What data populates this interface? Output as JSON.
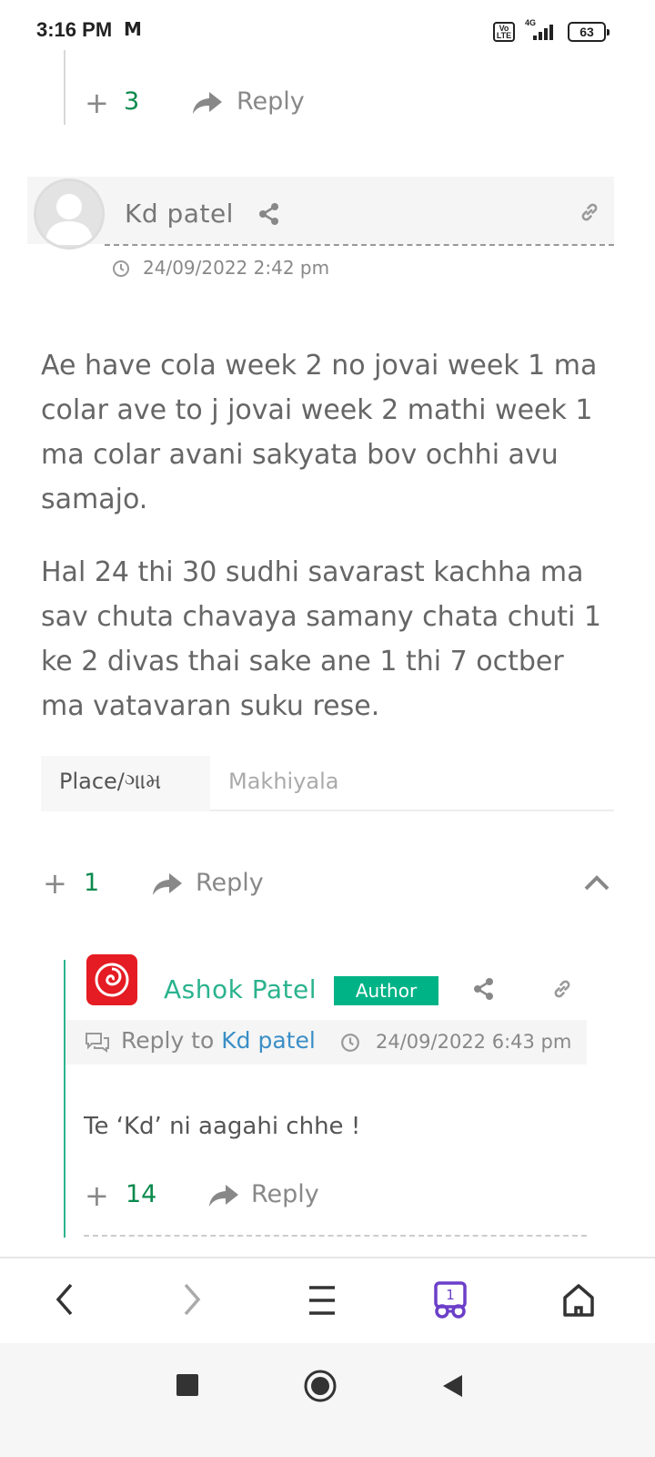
{
  "status_bar": {
    "time": "3:16 PM",
    "mail_glyph": "M",
    "volte": "Vo LTE",
    "network": "4G",
    "battery": "63"
  },
  "previous_comment": {
    "votes": "3",
    "reply_label": "Reply"
  },
  "comment": {
    "author": "Kd patel",
    "timestamp": "24/09/2022 2:42 pm",
    "paragraphs": [
      "Ae have cola week 2 no jovai week 1 ma colar ave to j jovai week 2 mathi week 1 ma colar avani sakyata bov ochhi avu samajo.",
      "Hal 24 thi 30 sudhi savarast kachha ma sav chuta chavaya samany chata chuti 1 ke 2 divas thai sake ane 1 thi 7 octber ma vatavaran suku rese."
    ],
    "place_label": "Place/ગામ",
    "place_value": "Makhiyala",
    "votes": "1",
    "reply_label": "Reply"
  },
  "reply": {
    "author": "Ashok Patel",
    "badge": "Author",
    "reply_to_prefix": "Reply to",
    "reply_to_name": "Kd patel",
    "timestamp": "24/09/2022 6:43 pm",
    "text": "Te ‘Kd’ ni aagahi chhe !",
    "votes": "14",
    "reply_label": "Reply"
  },
  "browser_nav": {
    "tab_count": "1"
  },
  "colors": {
    "accent_green": "#2bb38e",
    "vote_green": "#0a8a4d",
    "badge_green": "#00b386",
    "link_blue": "#3b8ec6",
    "tabs_purple": "#6b3fc9"
  }
}
